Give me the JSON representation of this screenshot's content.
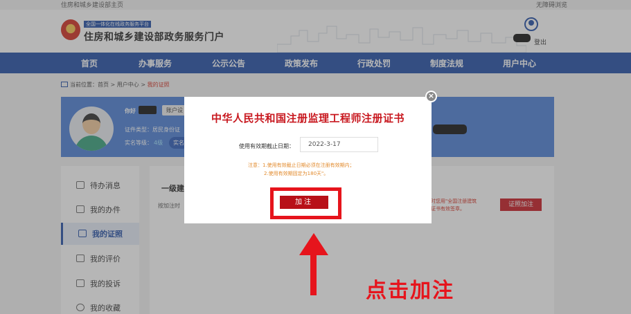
{
  "topbar": {
    "left": "住房和城乡建设部主页",
    "right": "无障碍浏览"
  },
  "header": {
    "tag": "全国一体化在线政务服务平台",
    "title": "住房和城乡建设部政务服务门户",
    "logout": "登出"
  },
  "nav": {
    "items": [
      "首页",
      "办事服务",
      "公示公告",
      "政策发布",
      "行政处罚",
      "制度法规",
      "用户中心"
    ]
  },
  "breadcrumb": {
    "prefix": "当前位置：",
    "path": "首页 > 用户中心 > ",
    "current": "我的证照"
  },
  "profile": {
    "greeting": "你好",
    "account_button": "账户设",
    "id_type": "证件类型：居民身份证",
    "auth_level": "实名等级：",
    "auth_value": "4级",
    "auth_button": "实名"
  },
  "sidebar": {
    "items": [
      {
        "label": "待办消息",
        "icon": "message-icon"
      },
      {
        "label": "我的办件",
        "icon": "document-icon"
      },
      {
        "label": "我的证照",
        "icon": "license-icon"
      },
      {
        "label": "我的评价",
        "icon": "comment-icon"
      },
      {
        "label": "我的投诉",
        "icon": "complaint-icon"
      },
      {
        "label": "我的收藏",
        "icon": "star-icon"
      }
    ],
    "active_index": 2
  },
  "content": {
    "heading": "一级建",
    "description": "按加注时",
    "right_note_1": "，同时您用\"全国注册建筑",
    "right_note_2": "注册证书有效签章。",
    "button": "证照加注"
  },
  "modal": {
    "title": "中华人民共和国注册监理工程师注册证书",
    "expiry_label": "使用有效期截止日期：",
    "expiry_value": "2022-3-17",
    "note_line_1": "注意：1.使用有效截止日期必须在注册有效期内；",
    "note_line_2": "2.使用有效期固定为180天\"。",
    "confirm_button": "加注",
    "close_symbol": "×"
  },
  "annotation": {
    "text": "点击加注"
  },
  "colors": {
    "primary_blue": "#1f4da5",
    "accent_red": "#c8181f",
    "highlight_red": "#e6141c",
    "note_orange": "#e28a2c"
  }
}
